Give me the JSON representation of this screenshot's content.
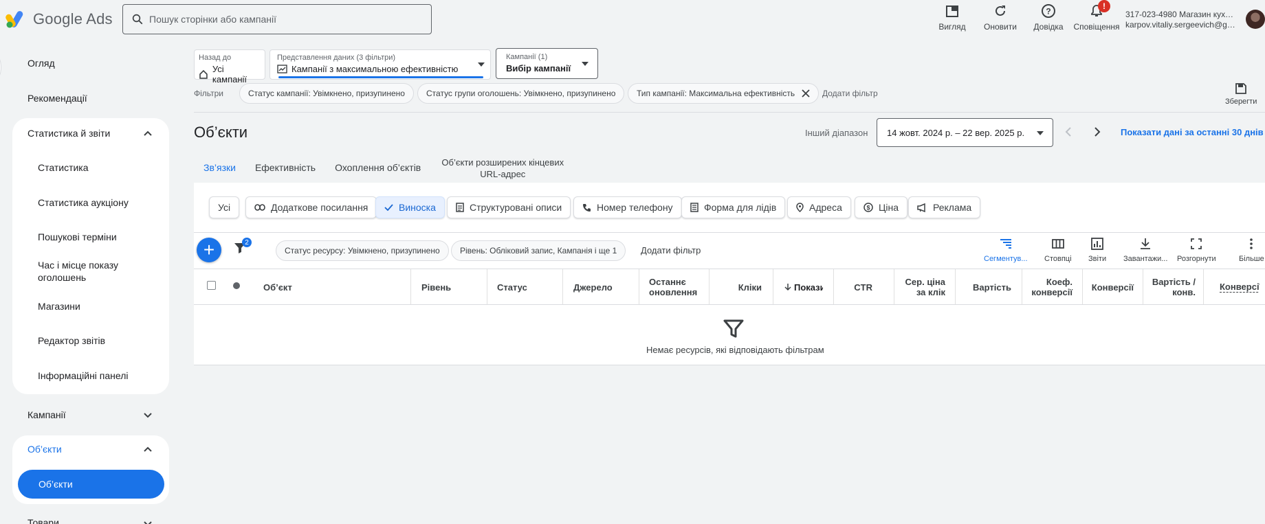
{
  "header": {
    "app_name": "Google Ads",
    "search_placeholder": "Пошук сторінки або кампанії",
    "actions": [
      {
        "label": "Вигляд",
        "icon": "appearance-icon"
      },
      {
        "label": "Оновити",
        "icon": "refresh-icon"
      },
      {
        "label": "Довідка",
        "icon": "help-icon"
      },
      {
        "label": "Сповіщення",
        "icon": "bell-icon",
        "badge": "!"
      }
    ],
    "account_line1": "317-023-4980 Магазин кухон...",
    "account_line2": "karpov.vitaliy.sergeevich@gm..."
  },
  "nav": {
    "overview": "Огляд",
    "recommendations": "Рекомендації",
    "stats_group": "Статистика й звіти",
    "stats_items": [
      "Статистика",
      "Статистика аукціону",
      "Пошукові терміни",
      "Час і місце показу оголошень",
      "Магазини",
      "Редактор звітів",
      "Інформаційні панелі"
    ],
    "campaigns": "Кампанії",
    "assets_group": "Об’єкти",
    "assets_active": "Об’єкти",
    "products": "Товари"
  },
  "filterbar": {
    "back_label": "Назад до",
    "back_value": "Усі кампанії",
    "view_label": "Представлення даних (3 фільтри)",
    "view_value": "Кампанії з максимальною ефективністю",
    "campaigns_label": "Кампанії (1)",
    "campaigns_value": "Вибір кампанії",
    "filters_label": "Фільтри",
    "chips": [
      "Статус кампанії: Увімкнено, призупинено",
      "Статус групи оголошень: Увімкнено, призупинено",
      "Тип кампанії: Максимальна ефективність"
    ],
    "add_filter": "Додати фільтр",
    "save": "Зберегти"
  },
  "page": {
    "title": "Об’єкти",
    "range_label": "Інший діапазон",
    "date_range": "14 жовт. 2024 р. – 22 вер. 2025 р.",
    "last30": "Показати дані за останні 30 днів",
    "tabs": [
      "Зв’язки",
      "Ефективність",
      "Охоплення об’єктів",
      "Об’єкти розширених кінцевих URL-адрес"
    ]
  },
  "asset_types": [
    {
      "label": "Усі",
      "icon": ""
    },
    {
      "label": "Додаткове посилання",
      "icon": "link-icon"
    },
    {
      "label": "Виноска",
      "icon": "check-icon"
    },
    {
      "label": "Структуровані описи",
      "icon": "document-icon"
    },
    {
      "label": "Номер телефону",
      "icon": "phone-icon"
    },
    {
      "label": "Форма для лідів",
      "icon": "form-icon"
    },
    {
      "label": "Адреса",
      "icon": "location-icon"
    },
    {
      "label": "Ціна",
      "icon": "price-icon"
    },
    {
      "label": "Реклама",
      "icon": "megaphone-icon"
    }
  ],
  "table_filters": {
    "filter_count": "2",
    "chips": [
      "Статус ресурсу: Увімкнено, призупинено",
      "Рівень: Обліковий запис, Кампанія і ще 1"
    ],
    "add_filter": "Додати фільтр"
  },
  "tools": [
    "Сегментув...",
    "Стовпці",
    "Звіти",
    "Завантажи...",
    "Розгорнути",
    "Більше"
  ],
  "columns": [
    "Об’єкт",
    "Рівень",
    "Статус",
    "Джерело",
    "Останнє оновлення",
    "Кліки",
    "Покази",
    "CTR",
    "Сер. ціна за клік",
    "Вартість",
    "Коеф. конверсії",
    "Конверсії",
    "Вартість / конв.",
    "Конверсії"
  ],
  "empty_message": "Немає ресурсів, які відповідають фільтрам",
  "colors": {
    "accent": "#1a73e8",
    "notification": "#d93025"
  }
}
